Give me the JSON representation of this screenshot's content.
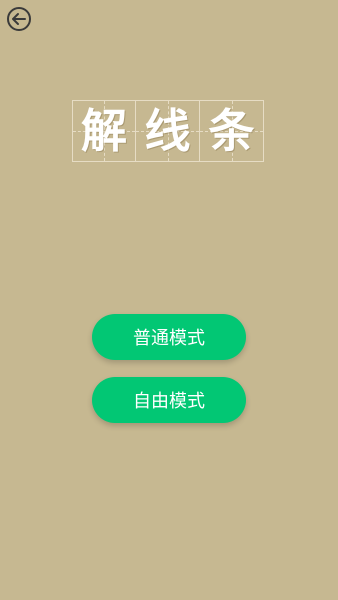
{
  "header": {
    "back_icon": "back-arrow-circle-icon"
  },
  "title": {
    "chars": [
      "解",
      "线",
      "条"
    ]
  },
  "menu": {
    "normal_mode_label": "普通模式",
    "free_mode_label": "自由模式"
  },
  "colors": {
    "background": "#c6b891",
    "button": "#02c774",
    "title_text": "#ffffff"
  }
}
